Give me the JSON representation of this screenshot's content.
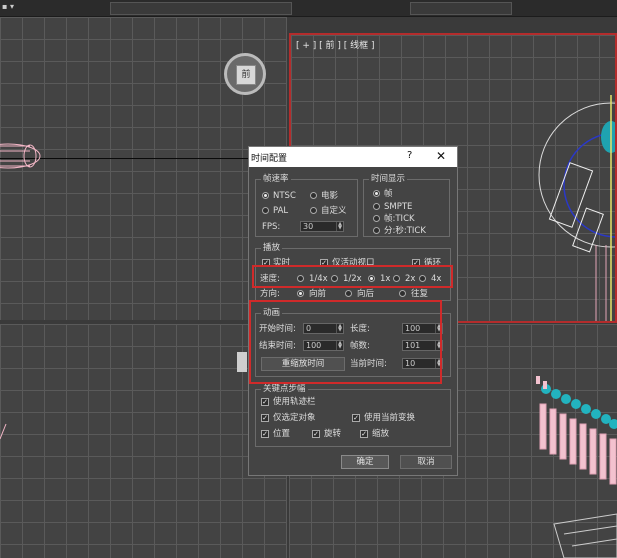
{
  "topbar": {
    "left_label": "▪ ▾"
  },
  "viewport_front": {
    "label": "[ + ] [ 前 ] [ 线框 ]"
  },
  "navcube": {
    "face": "前"
  },
  "dialog": {
    "title": "时间配置",
    "help": "?",
    "close": "✕",
    "frame_rate": {
      "group": "帧速率",
      "ntsc": "NTSC",
      "film": "电影",
      "pal": "PAL",
      "custom": "自定义",
      "fps_label": "FPS:",
      "fps_value": "30",
      "selected": "NTSC"
    },
    "time_display": {
      "group": "时间显示",
      "frames": "帧",
      "smpte": "SMPTE",
      "frame_tick": "帧:TICK",
      "min_sec_tick": "分:秒:TICK",
      "selected": "帧"
    },
    "playback": {
      "group": "播放",
      "realtime": "实时",
      "active_viewport": "仅活动视口",
      "loop": "循环",
      "speed_label": "速度:",
      "speeds": [
        "1/4x",
        "1/2x",
        "1x",
        "2x",
        "4x"
      ],
      "speed_selected": "1x",
      "direction_label": "方向:",
      "directions": [
        "向前",
        "向后",
        "往复"
      ],
      "direction_selected": "向前"
    },
    "animation": {
      "group": "动画",
      "start_label": "开始时间:",
      "start_value": "0",
      "length_label": "长度:",
      "length_value": "100",
      "end_label": "结束时间:",
      "end_value": "100",
      "frames_label": "帧数:",
      "frames_value": "101",
      "rescale": "重缩放时间",
      "current_label": "当前时间:",
      "current_value": "10"
    },
    "keys": {
      "group": "关键点步幅",
      "use_trackbar": "使用轨迹栏",
      "selected_only": "仅选定对象",
      "use_current_transform": "使用当前变换",
      "position": "位置",
      "rotation": "旋转",
      "scale": "缩放"
    },
    "ok": "确定",
    "cancel": "取消"
  },
  "colors": {
    "highlight": "#d02a2a",
    "viewport_bg": "#434343"
  }
}
